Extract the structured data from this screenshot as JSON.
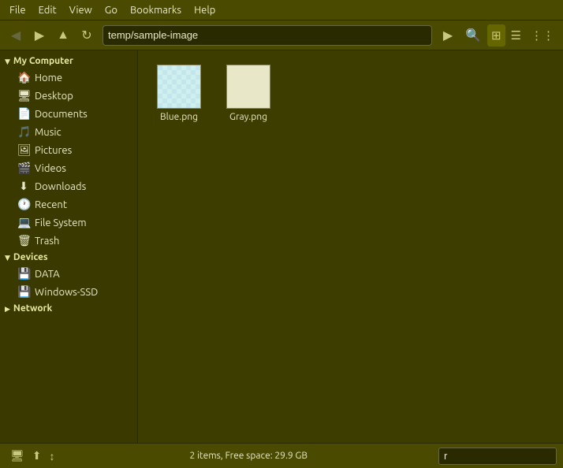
{
  "menubar": {
    "items": [
      "File",
      "Edit",
      "View",
      "Go",
      "Bookmarks",
      "Help"
    ]
  },
  "toolbar": {
    "back_label": "◀",
    "forward_label": "▶",
    "up_label": "▲",
    "reload_label": "↻",
    "address": "temp/sample-image",
    "go_label": "▶",
    "search_icon": "🔍",
    "view_grid": "⊞",
    "view_list": "☰",
    "view_compact": "⋮⋮"
  },
  "sidebar": {
    "my_computer_label": "My Computer",
    "items_computer": [
      {
        "id": "home",
        "label": "Home",
        "icon": "🏠"
      },
      {
        "id": "desktop",
        "label": "Desktop",
        "icon": "🖥"
      },
      {
        "id": "documents",
        "label": "Documents",
        "icon": "📄"
      },
      {
        "id": "music",
        "label": "Music",
        "icon": "🎵"
      },
      {
        "id": "pictures",
        "label": "Pictures",
        "icon": "🖼"
      },
      {
        "id": "videos",
        "label": "Videos",
        "icon": "🎬"
      },
      {
        "id": "downloads",
        "label": "Downloads",
        "icon": "⬇"
      },
      {
        "id": "recent",
        "label": "Recent",
        "icon": "🕐"
      },
      {
        "id": "filesystem",
        "label": "File System",
        "icon": "💻"
      },
      {
        "id": "trash",
        "label": "Trash",
        "icon": "🗑"
      }
    ],
    "devices_label": "Devices",
    "items_devices": [
      {
        "id": "data",
        "label": "DATA",
        "icon": "💾"
      },
      {
        "id": "windows-ssd",
        "label": "Windows-SSD",
        "icon": "💾"
      }
    ],
    "network_label": "Network"
  },
  "files": [
    {
      "id": "blue",
      "name": "Blue.png",
      "color": "#b8e0e0",
      "bg": "#d0f0f0"
    },
    {
      "id": "gray",
      "name": "Gray.png",
      "color": "#d8d8b0",
      "bg": "#e8e8c8"
    }
  ],
  "statusbar": {
    "status_text": "2 items, Free space: 29.9 GB",
    "search_placeholder": "r",
    "btn1": "🖥",
    "btn2": "⬆",
    "btn3": "↕"
  }
}
